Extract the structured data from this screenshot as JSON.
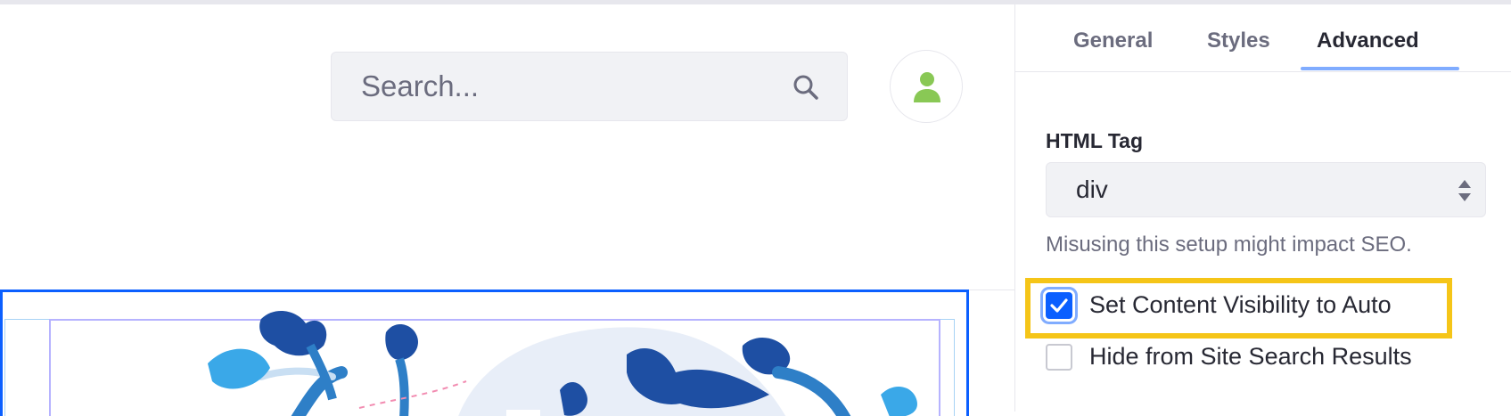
{
  "header": {
    "search": {
      "placeholder": "Search...",
      "icon": "search-icon"
    },
    "avatar": {
      "icon": "user-icon",
      "color": "#89c855"
    }
  },
  "panel": {
    "tabs": [
      {
        "label": "General",
        "active": false
      },
      {
        "label": "Styles",
        "active": false
      },
      {
        "label": "Advanced",
        "active": true
      }
    ],
    "html_tag": {
      "label": "HTML Tag",
      "selected": "div",
      "help": "Misusing this setup might impact SEO."
    },
    "options": [
      {
        "label": "Set Content Visibility to Auto",
        "checked": true
      },
      {
        "label": "Hide from Site Search Results",
        "checked": false
      }
    ]
  },
  "colors": {
    "accent": "#0b5fff",
    "highlight": "#f5c518",
    "fragment_border": "#0b5fff"
  }
}
